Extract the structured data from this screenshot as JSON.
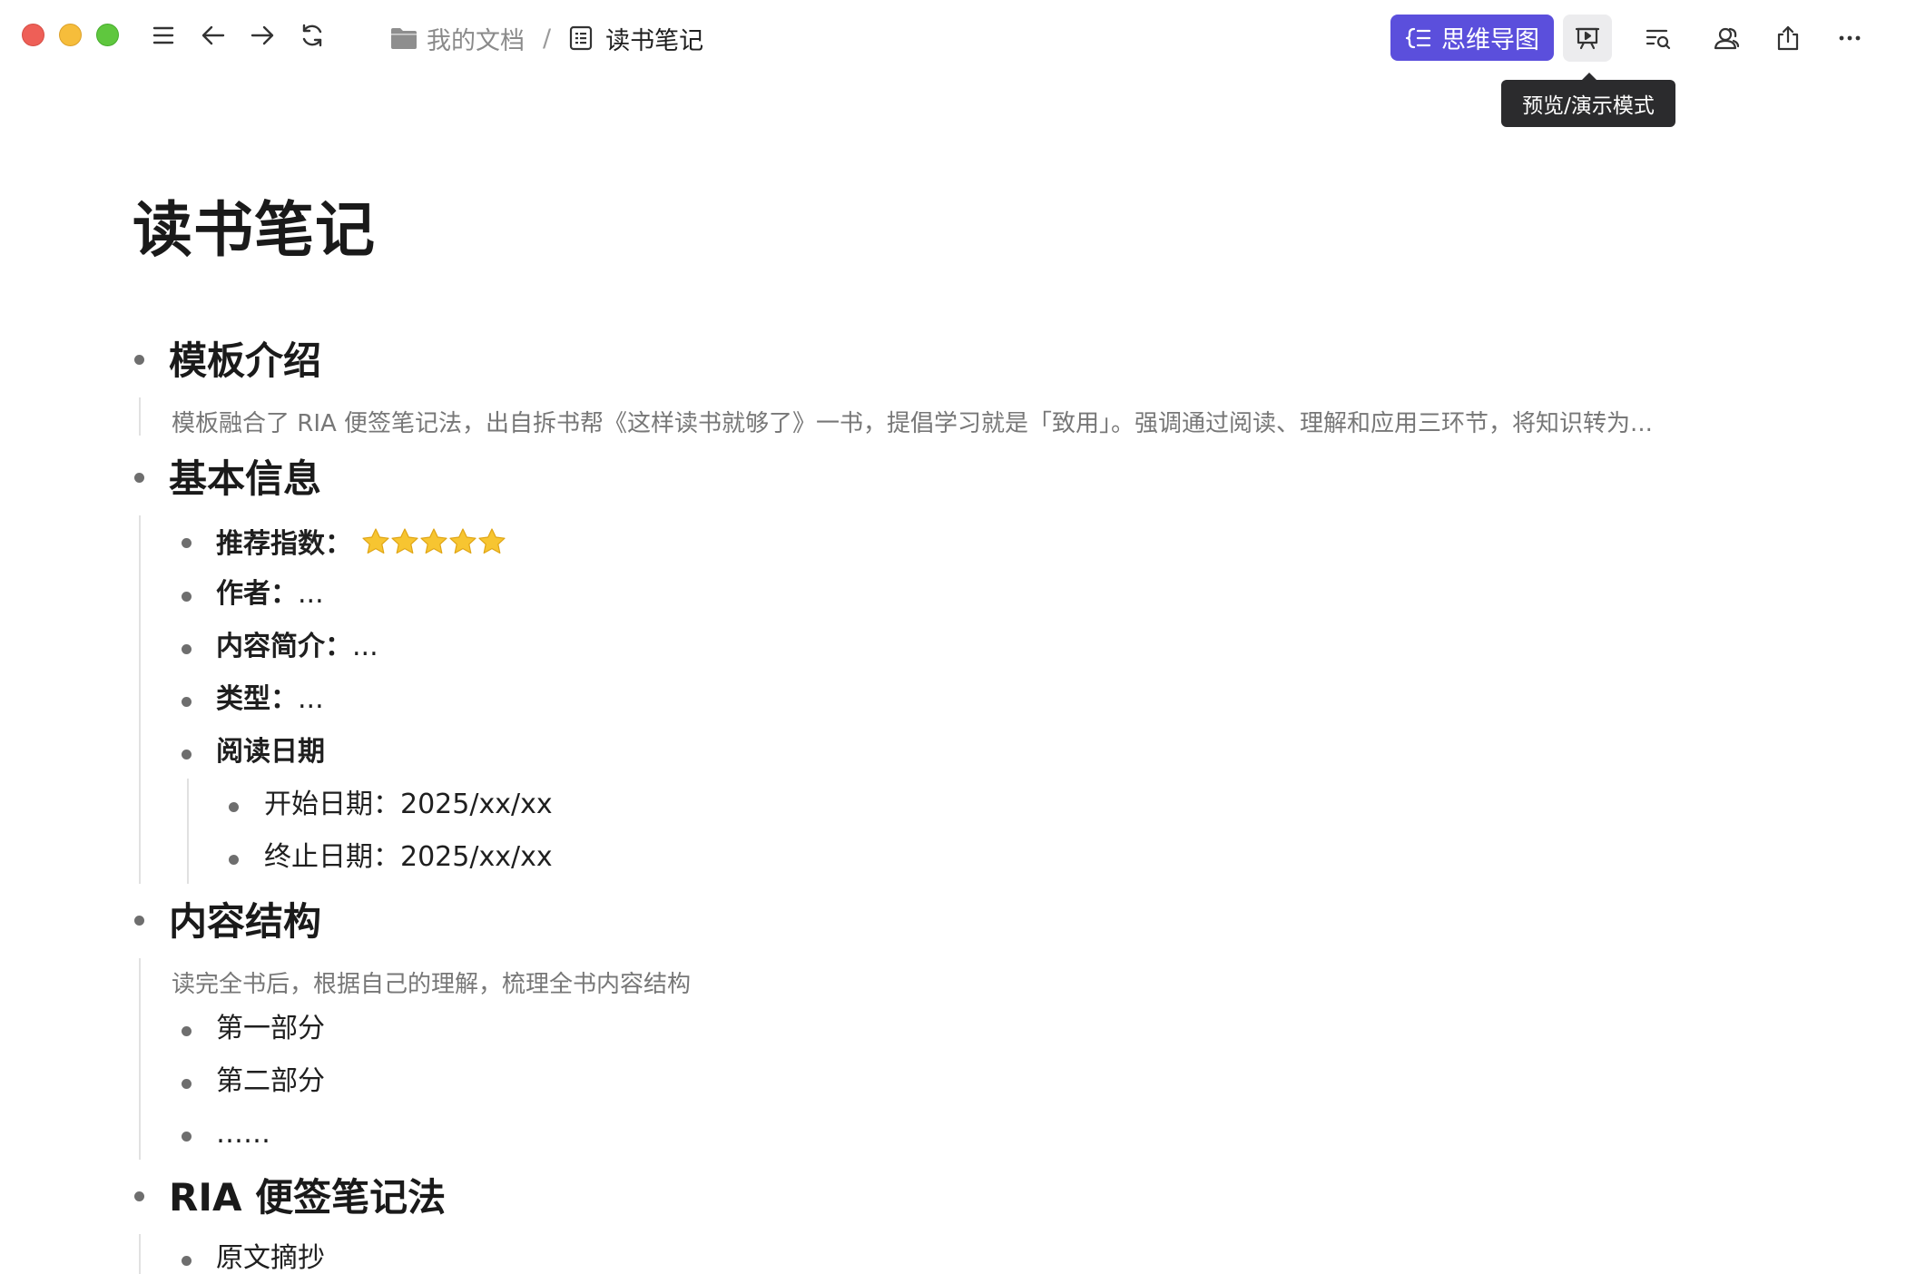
{
  "window": {
    "breadcrumb": {
      "folder": "我的文档",
      "separator": "/",
      "document": "读书笔记"
    }
  },
  "toolbar": {
    "mindmap_label": "思维导图",
    "tooltip": "预览/演示模式"
  },
  "document": {
    "title": "读书笔记",
    "sections": [
      {
        "heading": "模板介绍",
        "description": "模板融合了 RIA 便签笔记法，出自拆书帮《这样读书就够了》一书，提倡学习就是「致用」。强调通过阅读、理解和应用三环节，将知识转为..."
      },
      {
        "heading": "基本信息",
        "items": [
          {
            "label": "推荐指数：",
            "value": "",
            "rating": 5
          },
          {
            "label": "作者：",
            "value": "..."
          },
          {
            "label": "内容简介：",
            "value": "..."
          },
          {
            "label": "类型：",
            "value": "..."
          },
          {
            "label": "阅读日期",
            "value": ""
          }
        ],
        "subitems": [
          {
            "label": "开始日期：",
            "value": "2025/xx/xx"
          },
          {
            "label": "终止日期：",
            "value": "2025/xx/xx"
          }
        ]
      },
      {
        "heading": "内容结构",
        "description": "读完全书后，根据自己的理解，梳理全书内容结构",
        "items": [
          "第一部分",
          "第二部分",
          "……"
        ]
      },
      {
        "heading": "RIA 便签笔记法",
        "items": [
          "原文摘抄"
        ]
      }
    ]
  },
  "icons": {
    "traffic": [
      "close",
      "minimize",
      "maximize"
    ],
    "nav": [
      "sidebar-toggle-icon",
      "back-arrow-icon",
      "forward-arrow-icon",
      "refresh-icon"
    ],
    "tools": [
      "presentation-icon",
      "outline-search-icon",
      "collaborators-icon",
      "share-icon",
      "more-icon"
    ]
  },
  "colors": {
    "accent": "#5b4fdc",
    "star": "#f7c531"
  }
}
